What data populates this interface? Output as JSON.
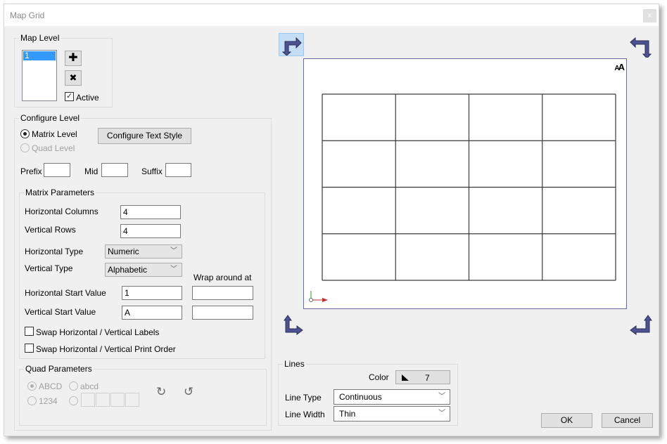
{
  "window": {
    "title": "Map Grid",
    "close_label": "x"
  },
  "map_level": {
    "group_label": "Map Level",
    "levels": [
      "1"
    ],
    "selected_level": "1",
    "add_icon": "plus-icon",
    "delete_icon": "x-icon",
    "active_label": "Active",
    "active_checked": true
  },
  "configure_level": {
    "group_label": "Configure Level",
    "matrix_level_label": "Matrix Level",
    "quad_level_label": "Quad Level",
    "selected_level_type": "Matrix Level",
    "configure_text_style_label": "Configure Text Style",
    "prefix_label": "Prefix",
    "prefix_value": "",
    "mid_label": "Mid",
    "mid_value": "",
    "suffix_label": "Suffix",
    "suffix_value": ""
  },
  "matrix_parameters": {
    "group_label": "Matrix Parameters",
    "horizontal_columns_label": "Horizontal Columns",
    "horizontal_columns_value": "4",
    "vertical_rows_label": "Vertical Rows",
    "vertical_rows_value": "4",
    "horizontal_type_label": "Horizontal Type",
    "horizontal_type_value": "Numeric",
    "vertical_type_label": "Vertical Type",
    "vertical_type_value": "Alphabetic",
    "wrap_around_label": "Wrap around at",
    "horizontal_start_label": "Horizontal Start Value",
    "horizontal_start_value": "1",
    "horizontal_wrap_value": "",
    "vertical_start_label": "Vertical Start Value",
    "vertical_start_value": "A",
    "vertical_wrap_value": "",
    "swap_labels_label": "Swap Horizontal / Vertical Labels",
    "swap_labels_checked": false,
    "swap_print_order_label": "Swap Horizontal / Vertical Print Order",
    "swap_print_order_checked": false
  },
  "quad_parameters": {
    "group_label": "Quad Parameters",
    "abcd_upper_label": "ABCD",
    "abcd_lower_label": "abcd",
    "numeric_label": "1234",
    "custom_values": [
      "",
      "",
      "",
      ""
    ],
    "rotate_cw_icon": "rotate-clockwise-icon",
    "rotate_ccw_icon": "rotate-counterclockwise-icon"
  },
  "preview": {
    "columns": 4,
    "rows": 4,
    "text_style_icon_label": "AA",
    "selected_corner": "top-left"
  },
  "lines": {
    "group_label": "Lines",
    "color_label": "Color",
    "color_value": "7",
    "line_type_label": "Line Type",
    "line_type_value": "Continuous",
    "line_width_label": "Line Width",
    "line_width_value": "Thin"
  },
  "buttons": {
    "ok_label": "OK",
    "cancel_label": "Cancel"
  },
  "colors": {
    "accent_selection": "#3399ff",
    "arrow_fill": "#4d5390",
    "corner_selected_bg": "#c5def5",
    "preview_border": "#6b6b9b"
  }
}
